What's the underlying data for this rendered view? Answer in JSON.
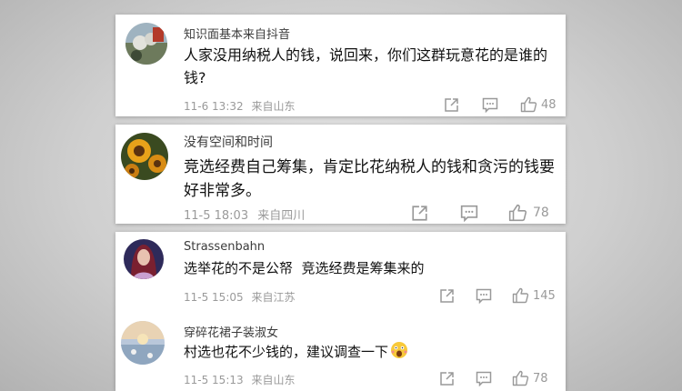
{
  "colors": {
    "text": "#111111",
    "username": "#3b3b3b",
    "meta": "#9a9a9a",
    "icon": "#999999"
  },
  "comments": [
    {
      "username": "知识面基本来自抖音",
      "text": "人家没用纳税人的钱，说回来，你们这群玩意花的是谁的钱?",
      "date": "11-6 13:32",
      "location": "来自山东",
      "likes": "48",
      "avatar_icon": "landscape-avatar-icon"
    },
    {
      "username": "没有空间和时间",
      "text": "竞选经费自己筹集，肯定比花纳税人的钱和贪污的钱要好非常多。",
      "date": "11-5 18:03",
      "location": "来自四川",
      "likes": "78",
      "avatar_icon": "sunflower-avatar-icon"
    },
    {
      "username": "Strassenbahn",
      "text": "选举花的不是公帑  竞选经费是筹集来的",
      "date": "11-5 15:05",
      "location": "来自江苏",
      "likes": "145",
      "avatar_icon": "portrait-avatar-icon"
    },
    {
      "username": "穿碎花裙子装淑女",
      "text": "村选也花不少钱的，建议调查一下",
      "date": "11-5 15:13",
      "location": "来自山东",
      "likes": "78",
      "avatar_icon": "sunset-avatar-icon",
      "emoji": "shocked-emoji-icon"
    }
  ]
}
